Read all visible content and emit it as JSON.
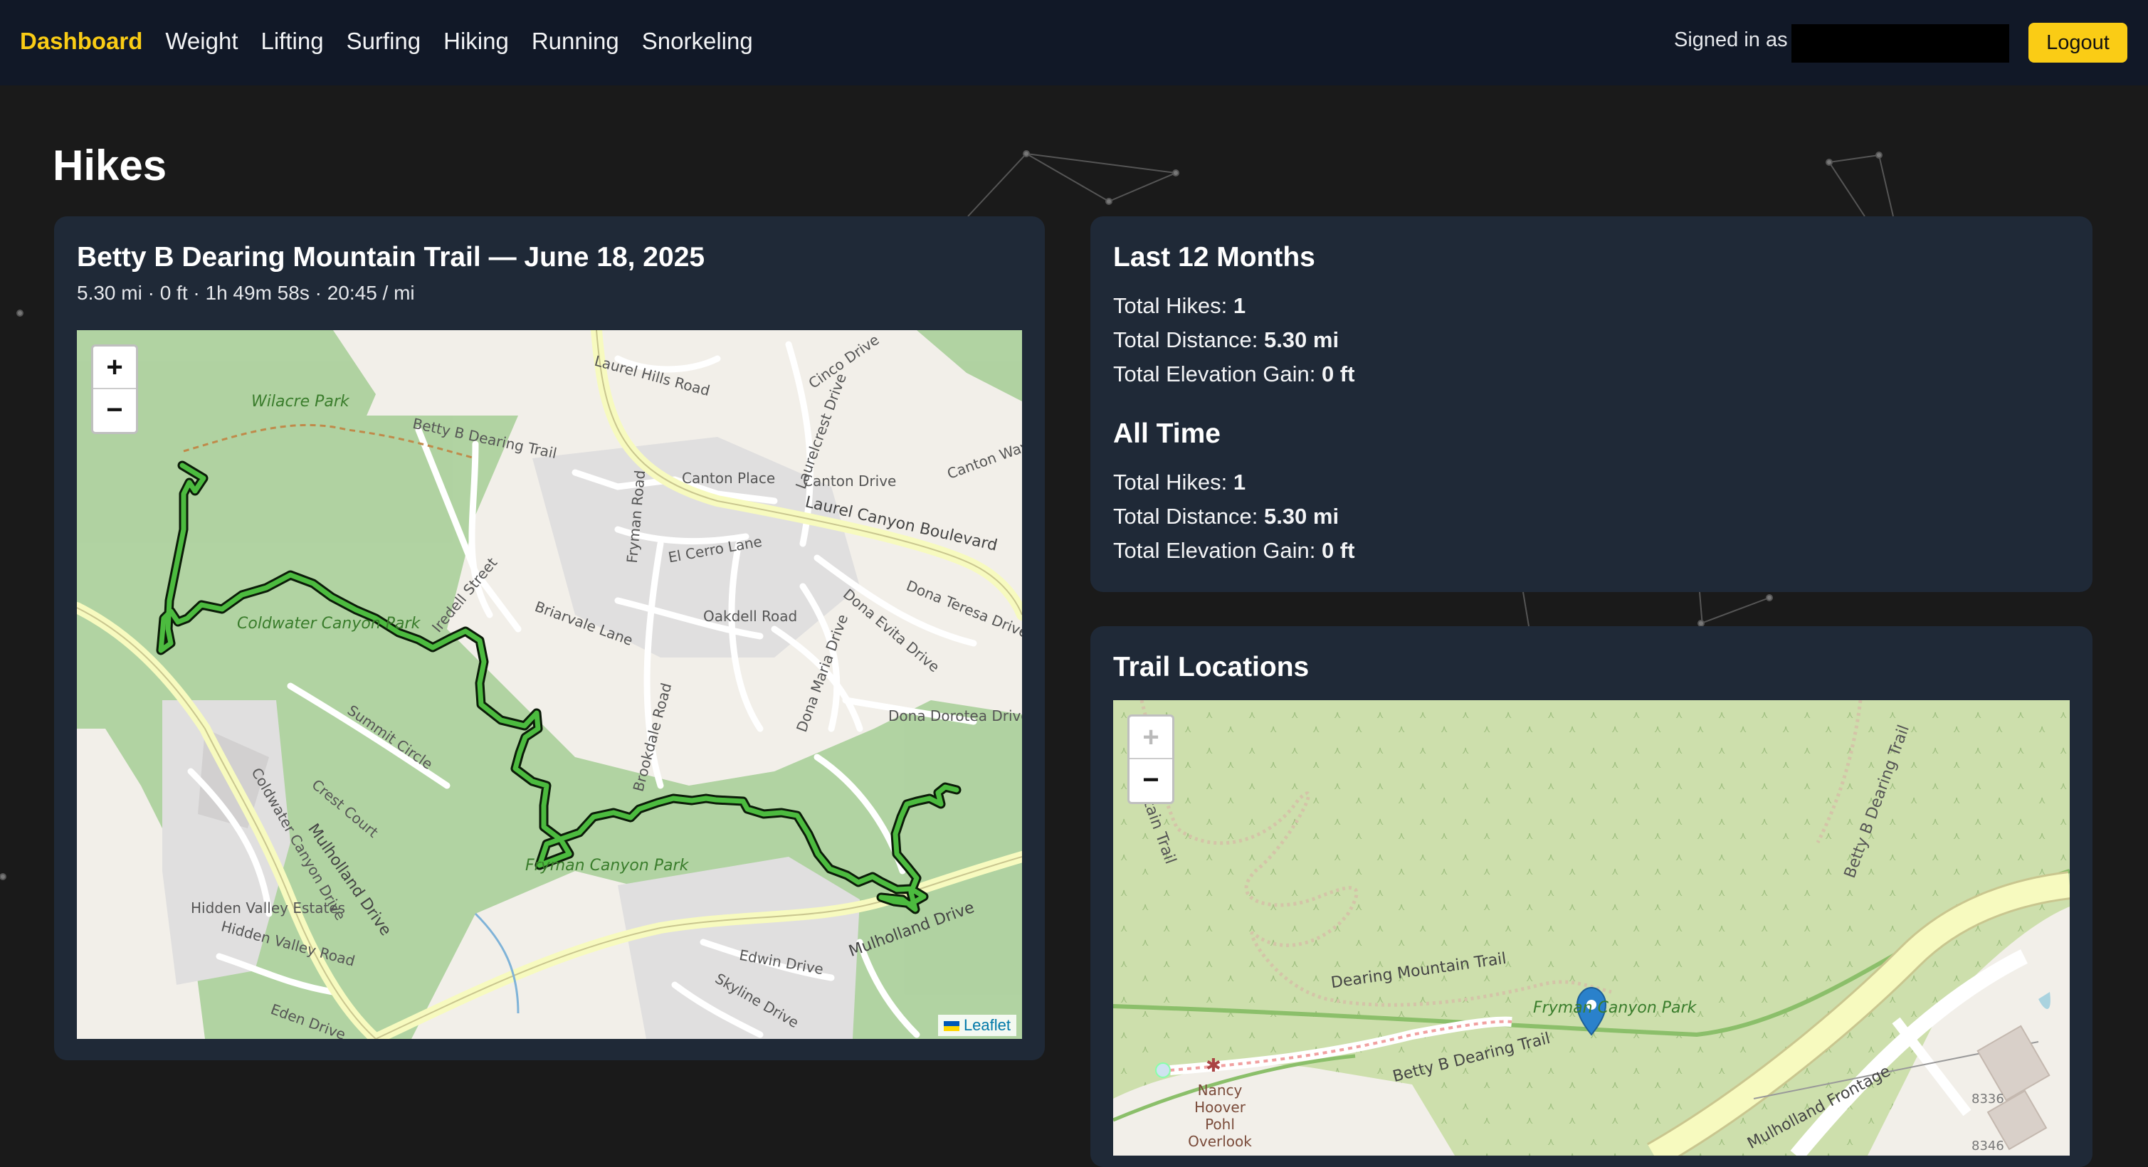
{
  "nav": {
    "brand": "Dashboard",
    "links": [
      "Weight",
      "Lifting",
      "Surfing",
      "Hiking",
      "Running",
      "Snorkeling"
    ],
    "signed_in_label": "Signed in as",
    "logout_label": "Logout"
  },
  "page": {
    "title": "Hikes"
  },
  "hike": {
    "title": "Betty B Dearing Mountain Trail — June 18, 2025",
    "stats": "5.30 mi · 0 ft · 1h 49m 58s · 20:45 / mi",
    "map": {
      "zoom_in": "+",
      "zoom_out": "−",
      "attribution": "Leaflet",
      "labels": {
        "wilacre": "Wilacre Park",
        "betty_trail": "Betty B Dearing Trail",
        "lauren_hills": "Laurel Hills Road",
        "cinco": "Cinco Drive",
        "laurelcrest": "Laurelcrest Drive",
        "canton_place": "Canton Place",
        "canton_drive": "Canton Drive",
        "canton_way": "Canton Way",
        "laurel_canyon": "Laurel Canyon Boulevard",
        "fryman_road": "Fryman Road",
        "el_cerro": "El Cerro Lane",
        "iredell": "Iredell Street",
        "briarvale": "Briarvale Lane",
        "oakdell": "Oakdell Road",
        "dona_teresa": "Dona Teresa Drive",
        "dona_evita": "Dona Evita Drive",
        "dona_maria": "Dona Maria Drive",
        "dona_dorotea": "Dona Dorotea Drive",
        "coldwater_park": "Coldwater Canyon Park",
        "summit_circle": "Summit Circle",
        "crest_court": "Crest Court",
        "coldwater_canyon_drive": "Coldwater Canyon Drive",
        "mulholland": "Mulholland Drive",
        "hidden_valley_estates": "Hidden Valley Estates",
        "hidden_valley_road": "Hidden Valley Road",
        "eden": "Eden Drive",
        "fryman_park": "Fryman Canyon Park",
        "edwin": "Edwin Drive",
        "skyline": "Skyline Drive",
        "brookdale": "Brookdale Road"
      }
    }
  },
  "stats": {
    "last12": {
      "heading": "Last 12 Months",
      "hikes_label": "Total Hikes:",
      "hikes_value": "1",
      "distance_label": "Total Distance:",
      "distance_value": "5.30 mi",
      "elevation_label": "Total Elevation Gain:",
      "elevation_value": "0 ft"
    },
    "alltime": {
      "heading": "All Time",
      "hikes_label": "Total Hikes:",
      "hikes_value": "1",
      "distance_label": "Total Distance:",
      "distance_value": "5.30 mi",
      "elevation_label": "Total Elevation Gain:",
      "elevation_value": "0 ft"
    }
  },
  "locations": {
    "heading": "Trail Locations",
    "map": {
      "zoom_in": "+",
      "zoom_out": "−",
      "labels": {
        "mountain_trail": "Mountain Trail",
        "betty_dearing_trail_top": "Betty B Dearing Trail",
        "dearing_mountain_trail": "Dearing Mountain Trail",
        "fryman_canyon_park": "Fryman Canyon Park",
        "betty_dearing_trail": "Betty B Dearing Trail",
        "nancy_hoover": "Nancy Hoover Pohl Overlook",
        "mulholland_frontage": "Mulholland Frontage",
        "num_8336": "8336",
        "num_8346": "8346"
      }
    }
  },
  "colors": {
    "navbar_bg": "#111827",
    "accent": "#facc15",
    "card_bg": "#1f2937",
    "page_bg": "#1a1a1a",
    "track": "#4cbb3f",
    "marker": "#2a81cb"
  }
}
